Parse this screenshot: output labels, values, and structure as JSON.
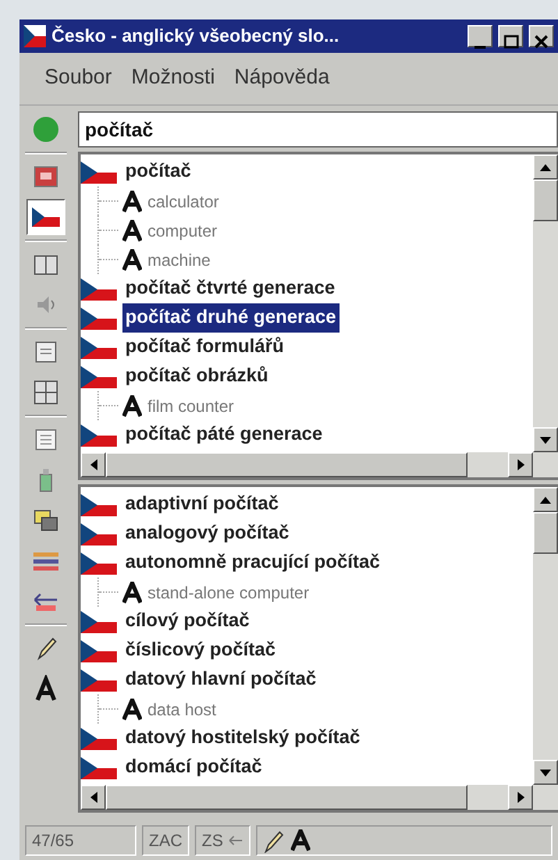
{
  "window": {
    "title": "Česko - anglický všeobecný slo..."
  },
  "menu": [
    "Soubor",
    "Možnosti",
    "Nápověda"
  ],
  "toolbar": [
    {
      "selected": false
    },
    {
      "selected": false
    },
    {
      "selected": true
    },
    {
      "selected": false
    },
    {
      "selected": false
    },
    {
      "selected": false
    },
    {
      "selected": false
    },
    {
      "selected": false
    },
    {
      "selected": false
    },
    {
      "selected": false
    },
    {
      "selected": false
    },
    {
      "selected": false
    },
    {
      "selected": false
    },
    {
      "selected": false
    }
  ],
  "search": {
    "value": "počítač"
  },
  "upper_list": [
    {
      "kind": "headword",
      "text": "počítač",
      "selected": false
    },
    {
      "kind": "translation",
      "text": "calculator",
      "selected": false
    },
    {
      "kind": "translation",
      "text": "computer",
      "selected": false
    },
    {
      "kind": "translation",
      "text": "machine",
      "selected": false
    },
    {
      "kind": "headword",
      "text": "počítač čtvrté generace",
      "selected": false
    },
    {
      "kind": "headword",
      "text": "počítač druhé generace",
      "selected": true
    },
    {
      "kind": "headword",
      "text": "počítač formulářů",
      "selected": false
    },
    {
      "kind": "headword",
      "text": "počítač obrázků",
      "selected": false
    },
    {
      "kind": "translation",
      "text": "film counter",
      "selected": false
    },
    {
      "kind": "headword",
      "text": "počítač páté generace",
      "selected": false
    }
  ],
  "lower_list": [
    {
      "kind": "headword",
      "text": "adaptivní počítač",
      "selected": false
    },
    {
      "kind": "headword",
      "text": "analogový počítač",
      "selected": false
    },
    {
      "kind": "headword",
      "text": "autonomně pracující počítač",
      "selected": false
    },
    {
      "kind": "translation",
      "text": "stand-alone computer",
      "selected": false
    },
    {
      "kind": "headword",
      "text": "cílový počítač",
      "selected": false
    },
    {
      "kind": "headword",
      "text": "číslicový počítač",
      "selected": false
    },
    {
      "kind": "headword",
      "text": "datový hlavní počítač",
      "selected": false
    },
    {
      "kind": "translation",
      "text": "data host",
      "selected": false
    },
    {
      "kind": "headword",
      "text": "datový hostitelský počítač",
      "selected": false
    },
    {
      "kind": "headword",
      "text": "domácí počítač",
      "selected": false
    }
  ],
  "status_bar": {
    "count": "47/65",
    "mode": "ZAC",
    "direction": "ZS"
  }
}
